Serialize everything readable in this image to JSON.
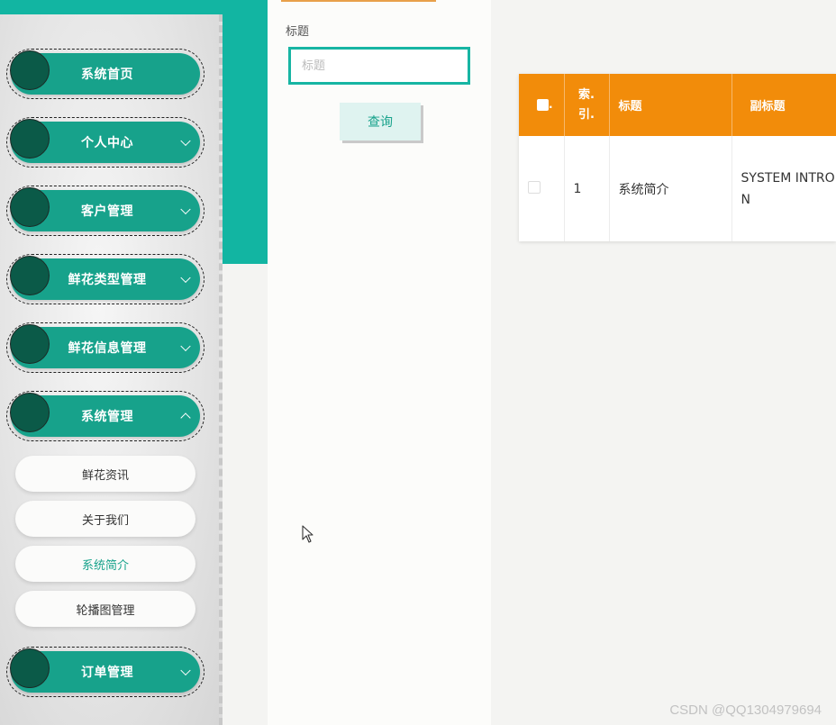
{
  "sidebar": {
    "menu": [
      {
        "label": "系统首页",
        "chevron": "none"
      },
      {
        "label": "个人中心",
        "chevron": "down"
      },
      {
        "label": "客户管理",
        "chevron": "down"
      },
      {
        "label": "鲜花类型管理",
        "chevron": "down"
      },
      {
        "label": "鲜花信息管理",
        "chevron": "down"
      },
      {
        "label": "系统管理",
        "chevron": "up",
        "expanded": true
      },
      {
        "label": "订单管理",
        "chevron": "down"
      }
    ],
    "submenu": [
      {
        "label": "鲜花资讯"
      },
      {
        "label": "关于我们"
      },
      {
        "label": "系统简介",
        "active": true
      },
      {
        "label": "轮播图管理"
      }
    ]
  },
  "search": {
    "field_label": "标题",
    "placeholder": "标题",
    "value": "",
    "button_label": "查询"
  },
  "table": {
    "headers": {
      "index": "索.\n引.",
      "title": "标题",
      "subtitle": "副标题"
    },
    "rows": [
      {
        "index": "1",
        "title": "系统简介",
        "subtitle": "SYSTEM INTRODUCTION",
        "checked": false
      }
    ]
  },
  "watermark": "CSDN @QQ1304979694",
  "colors": {
    "teal": "#12b5a2",
    "menu_pill": "#17a28b",
    "menu_circle": "#0b5a48",
    "table_header": "#f28c0a",
    "active_text": "#17a28b"
  }
}
